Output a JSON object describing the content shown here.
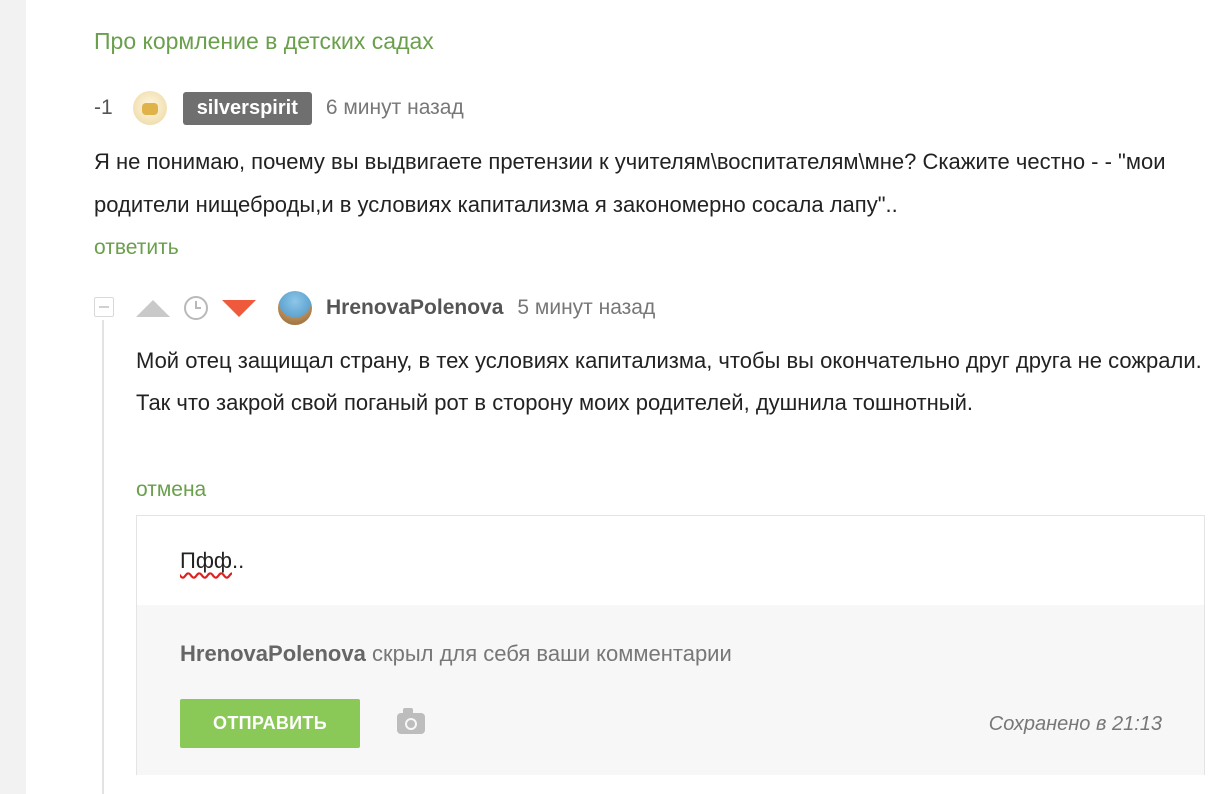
{
  "story": {
    "title": "Про кормление в детских садах"
  },
  "comment1": {
    "rating": "-1",
    "username": "silverspirit",
    "time": "6 минут назад",
    "text": "Я не понимаю, почему вы выдвигаете претензии к учителям\\воспитателям\\мне? Скажите честно - - \"мои родители нищеброды,и в условиях капитализма я закономерно сосала лапу\"..",
    "reply_label": "ответить"
  },
  "comment2": {
    "username": "HrenovaPolenova",
    "time": "5 минут назад",
    "text": "Мой отец защищал страну, в тех условиях капитализма, чтобы вы окончательно друг друга не сожрали. Так что закрой свой поганый рот в сторону моих родителей, душнила тошнотный.",
    "cancel_label": "отмена"
  },
  "editor": {
    "draft": "Пфф",
    "draft_suffix": "..",
    "notice_user": "HrenovaPolenova",
    "notice_text": " скрыл для себя ваши комментарии",
    "send_label": "ОТПРАВИТЬ",
    "saved_status": "Сохранено в 21:13"
  },
  "icons": {
    "vote_up": "arrow-up-icon",
    "history": "clock-icon",
    "vote_down": "arrow-down-icon",
    "attach": "camera-icon",
    "collapse": "minus-icon"
  },
  "colors": {
    "accent_green": "#6a9f4c",
    "button_green": "#8ac858",
    "downvote_red": "#ef5a3d",
    "badge_gray": "#6f6f6f"
  }
}
